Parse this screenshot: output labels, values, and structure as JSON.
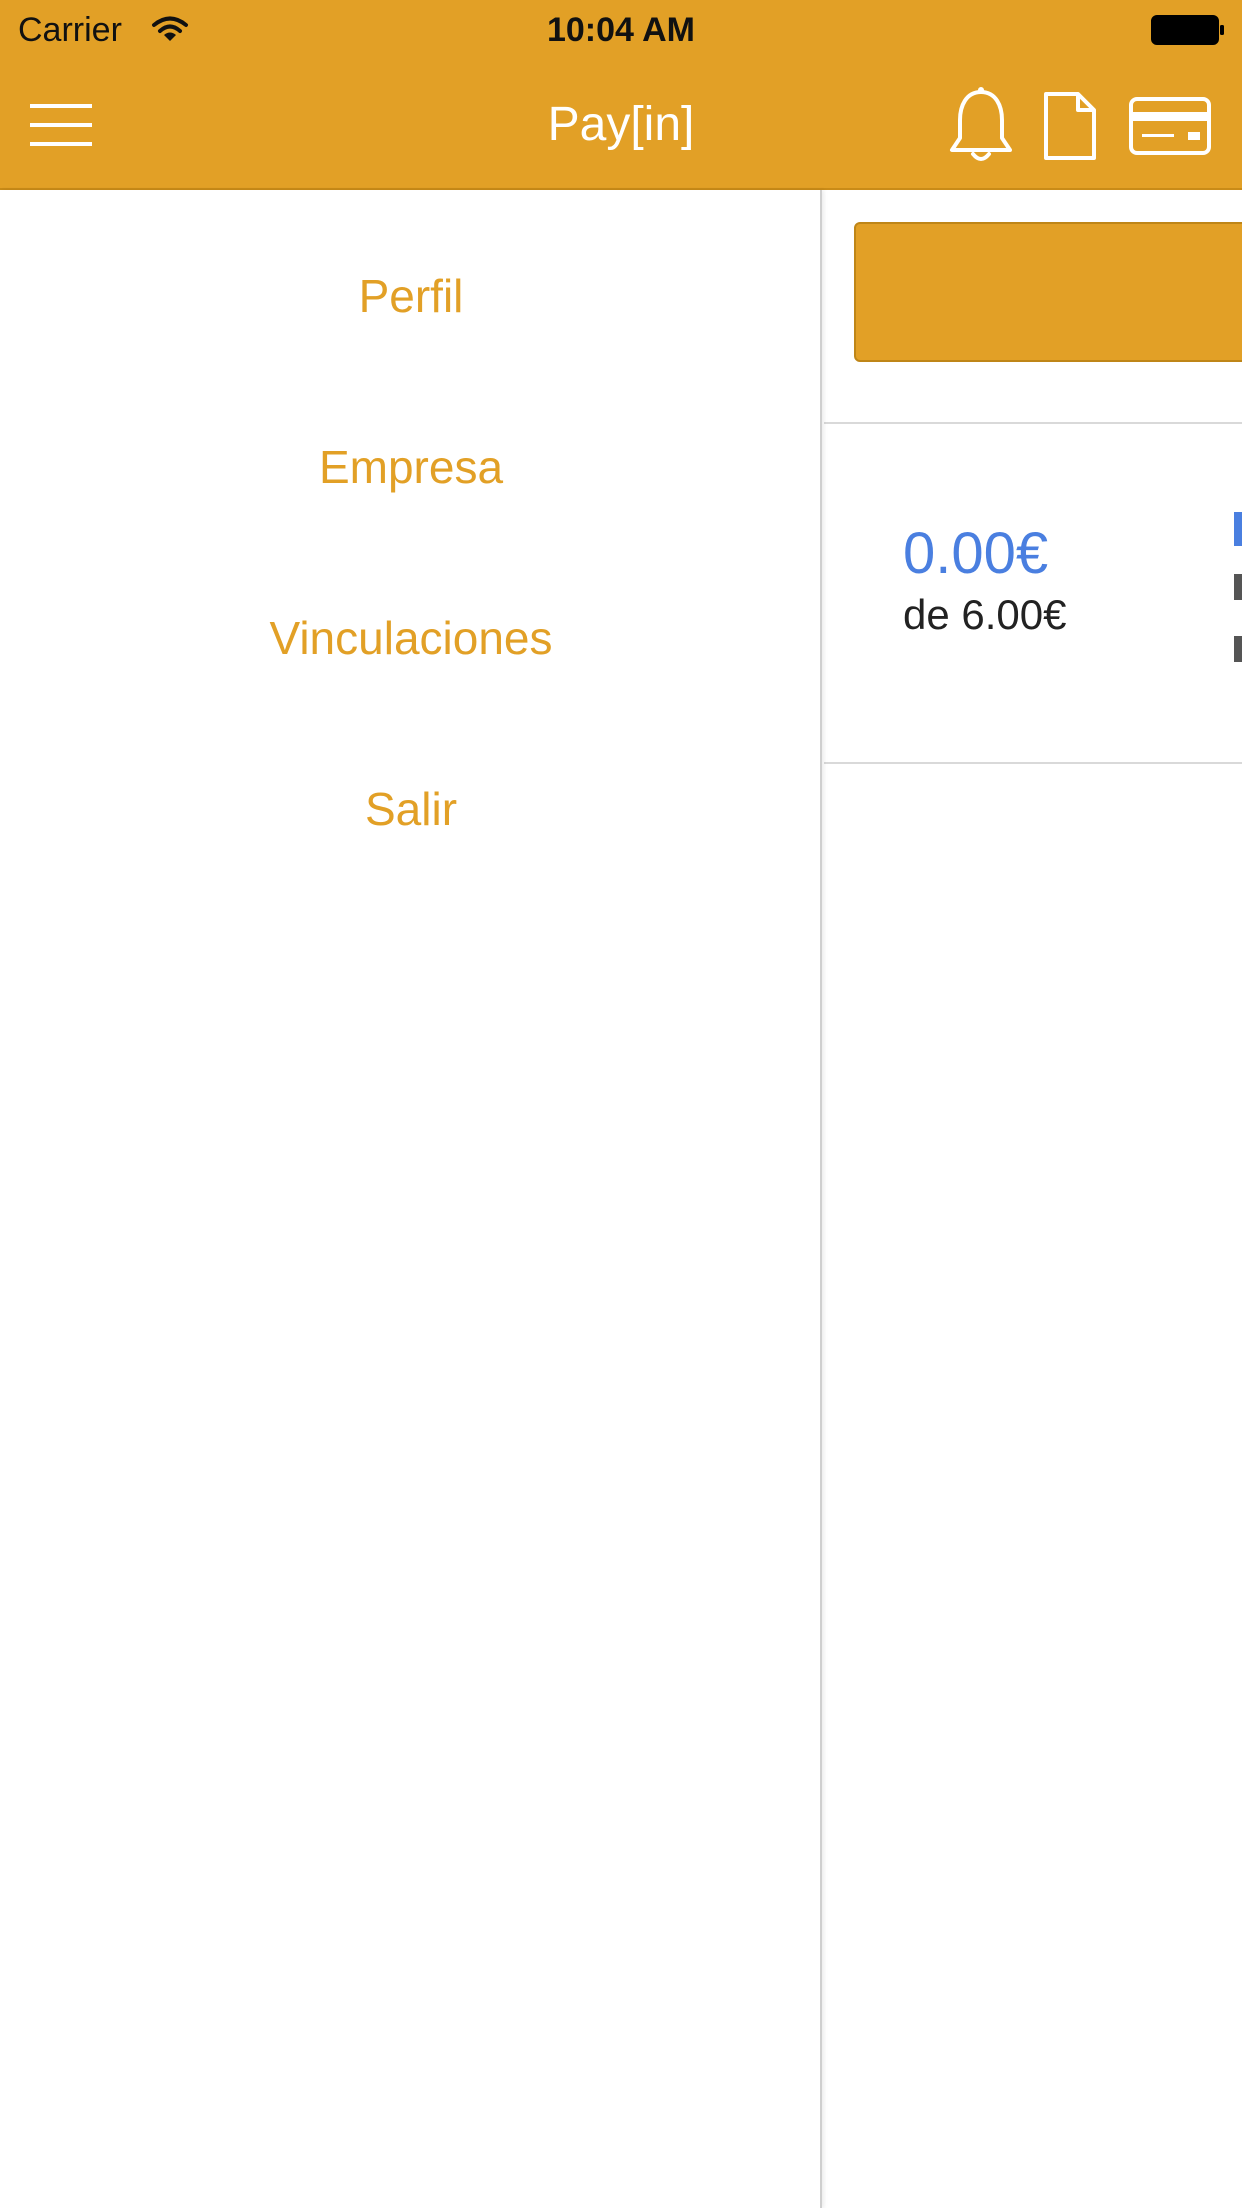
{
  "status_bar": {
    "carrier": "Carrier",
    "time": "10:04 AM"
  },
  "nav": {
    "title": "Pay[in]",
    "icons": [
      "menu-icon",
      "bell-icon",
      "document-icon",
      "card-icon"
    ]
  },
  "side_menu": {
    "items": [
      {
        "label": "Perfil"
      },
      {
        "label": "Empresa"
      },
      {
        "label": "Vinculaciones"
      },
      {
        "label": "Salir"
      }
    ]
  },
  "main": {
    "balance": {
      "amount": "0.00€",
      "total": "de 6.00€"
    }
  },
  "colors": {
    "accent": "#E2A026",
    "amount": "#4A7FE0",
    "text_dark": "#222222"
  }
}
